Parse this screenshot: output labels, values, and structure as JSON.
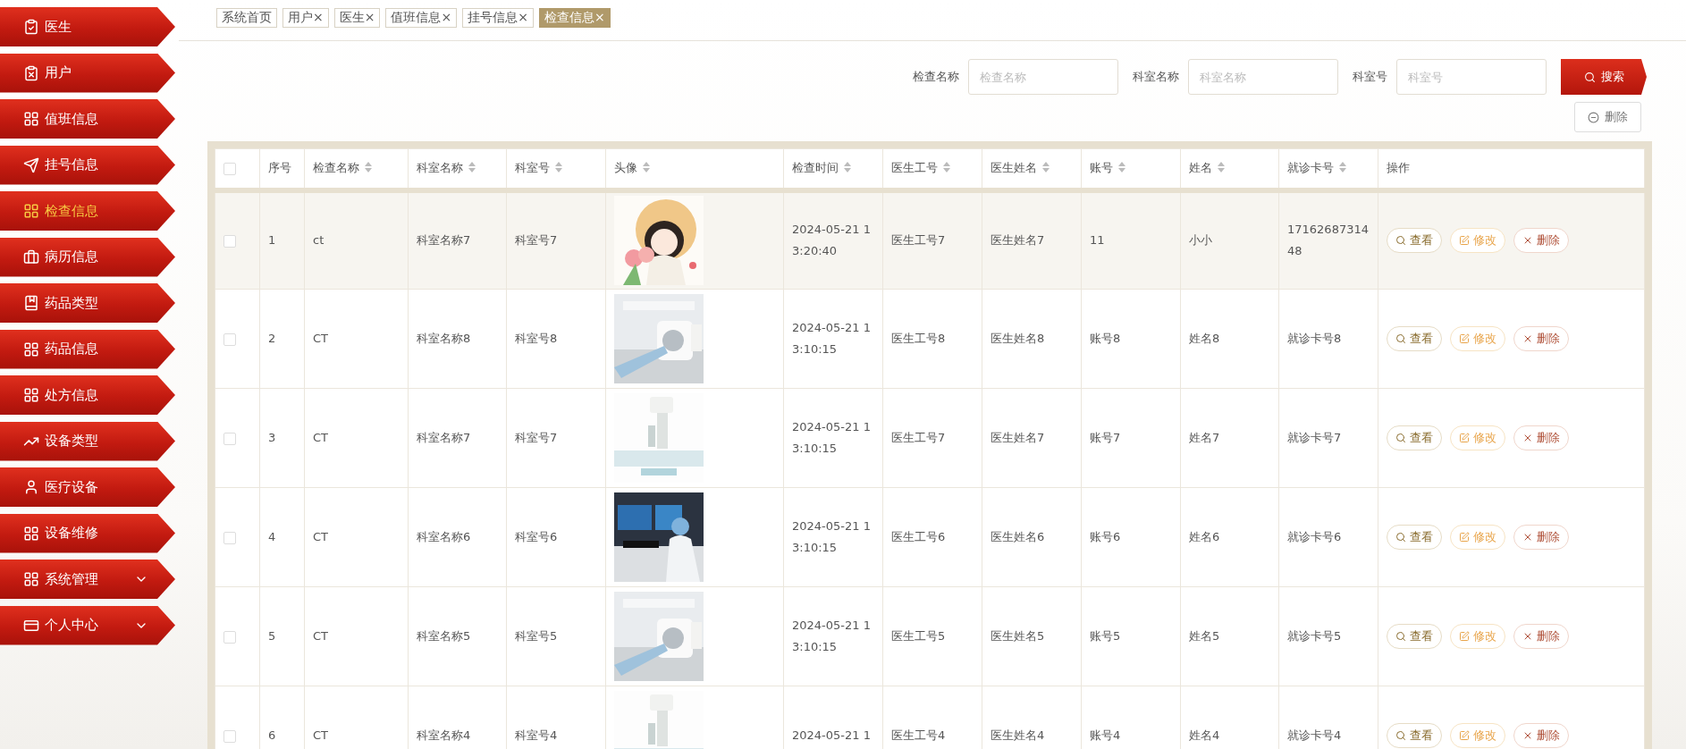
{
  "sidebar": {
    "items": [
      {
        "label": "医生",
        "selected": false,
        "expandable": false
      },
      {
        "label": "用户",
        "selected": false,
        "expandable": false
      },
      {
        "label": "值班信息",
        "selected": false,
        "expandable": false
      },
      {
        "label": "挂号信息",
        "selected": false,
        "expandable": false
      },
      {
        "label": "检查信息",
        "selected": true,
        "expandable": false
      },
      {
        "label": "病历信息",
        "selected": false,
        "expandable": false
      },
      {
        "label": "药品类型",
        "selected": false,
        "expandable": false
      },
      {
        "label": "药品信息",
        "selected": false,
        "expandable": false
      },
      {
        "label": "处方信息",
        "selected": false,
        "expandable": false
      },
      {
        "label": "设备类型",
        "selected": false,
        "expandable": false
      },
      {
        "label": "医疗设备",
        "selected": false,
        "expandable": false
      },
      {
        "label": "设备维修",
        "selected": false,
        "expandable": false
      },
      {
        "label": "系统管理",
        "selected": false,
        "expandable": true
      },
      {
        "label": "个人中心",
        "selected": false,
        "expandable": true
      }
    ]
  },
  "tabs": [
    {
      "label": "系统首页",
      "selected": false
    },
    {
      "label": "用户",
      "selected": false,
      "close": "×"
    },
    {
      "label": "医生",
      "selected": false,
      "close": "×"
    },
    {
      "label": "值班信息",
      "selected": false,
      "close": "×"
    },
    {
      "label": "挂号信息",
      "selected": false,
      "close": "×"
    },
    {
      "label": "检查信息",
      "selected": true,
      "close": "×"
    }
  ],
  "search": {
    "fields": [
      {
        "label": "检查名称",
        "placeholder": "检查名称"
      },
      {
        "label": "科室名称",
        "placeholder": "科室名称"
      },
      {
        "label": "科室号",
        "placeholder": "科室号"
      }
    ],
    "button": "搜索"
  },
  "delete_button": "删除",
  "table": {
    "all_checked": false,
    "columns": [
      {
        "label": "序号",
        "sortable": false
      },
      {
        "label": "检查名称",
        "sortable": true
      },
      {
        "label": "科室名称",
        "sortable": true
      },
      {
        "label": "科室号",
        "sortable": true
      },
      {
        "label": "头像",
        "sortable": true
      },
      {
        "label": "检查时间",
        "sortable": true
      },
      {
        "label": "医生工号",
        "sortable": true
      },
      {
        "label": "医生姓名",
        "sortable": true
      },
      {
        "label": "账号",
        "sortable": true
      },
      {
        "label": "姓名",
        "sortable": true
      },
      {
        "label": "就诊卡号",
        "sortable": true
      },
      {
        "label": "操作",
        "sortable": false
      }
    ],
    "rows": [
      {
        "highlighted": true,
        "checked": false,
        "cells": [
          "1",
          "ct",
          "科室名称7",
          "科室号7",
          "",
          "2024-05-21 13:20:40",
          "医生工号7",
          "医生姓名7",
          "11",
          "小小",
          "1716268731448"
        ],
        "picture": {
          "kind": "picture"
        },
        "actions": [
          "查看",
          "修改",
          "删除"
        ]
      },
      {
        "highlighted": false,
        "checked": false,
        "cells": [
          "2",
          "CT",
          "科室名称8",
          "科室号8",
          "",
          "2024-05-21 13:10:15",
          "医生工号8",
          "医生姓名8",
          "账号8",
          "姓名8",
          "就诊卡号8"
        ],
        "picture": {
          "kind": "picture"
        },
        "actions": [
          "查看",
          "修改",
          "删除"
        ]
      },
      {
        "highlighted": false,
        "checked": false,
        "cells": [
          "3",
          "CT",
          "科室名称7",
          "科室号7",
          "",
          "2024-05-21 13:10:15",
          "医生工号7",
          "医生姓名7",
          "账号7",
          "姓名7",
          "就诊卡号7"
        ],
        "picture": {
          "kind": "picture"
        },
        "actions": [
          "查看",
          "修改",
          "删除"
        ]
      },
      {
        "highlighted": false,
        "checked": false,
        "cells": [
          "4",
          "CT",
          "科室名称6",
          "科室号6",
          "",
          "2024-05-21 13:10:15",
          "医生工号6",
          "医生姓名6",
          "账号6",
          "姓名6",
          "就诊卡号6"
        ],
        "picture": {
          "kind": "picture"
        },
        "actions": [
          "查看",
          "修改",
          "删除"
        ]
      },
      {
        "highlighted": false,
        "checked": false,
        "cells": [
          "5",
          "CT",
          "科室名称5",
          "科室号5",
          "",
          "2024-05-21 13:10:15",
          "医生工号5",
          "医生姓名5",
          "账号5",
          "姓名5",
          "就诊卡号5"
        ],
        "picture": {
          "kind": "picture"
        },
        "actions": [
          "查看",
          "修改",
          "删除"
        ]
      },
      {
        "highlighted": false,
        "checked": false,
        "cells": [
          "6",
          "CT",
          "科室名称4",
          "科室号4",
          "",
          "2024-05-21 1",
          "医生工号4",
          "医生姓名4",
          "账号4",
          "姓名4",
          "就诊卡号4"
        ],
        "picture": {
          "kind": "picture"
        },
        "actions": [
          "查看",
          "修改",
          "删除"
        ]
      }
    ]
  }
}
